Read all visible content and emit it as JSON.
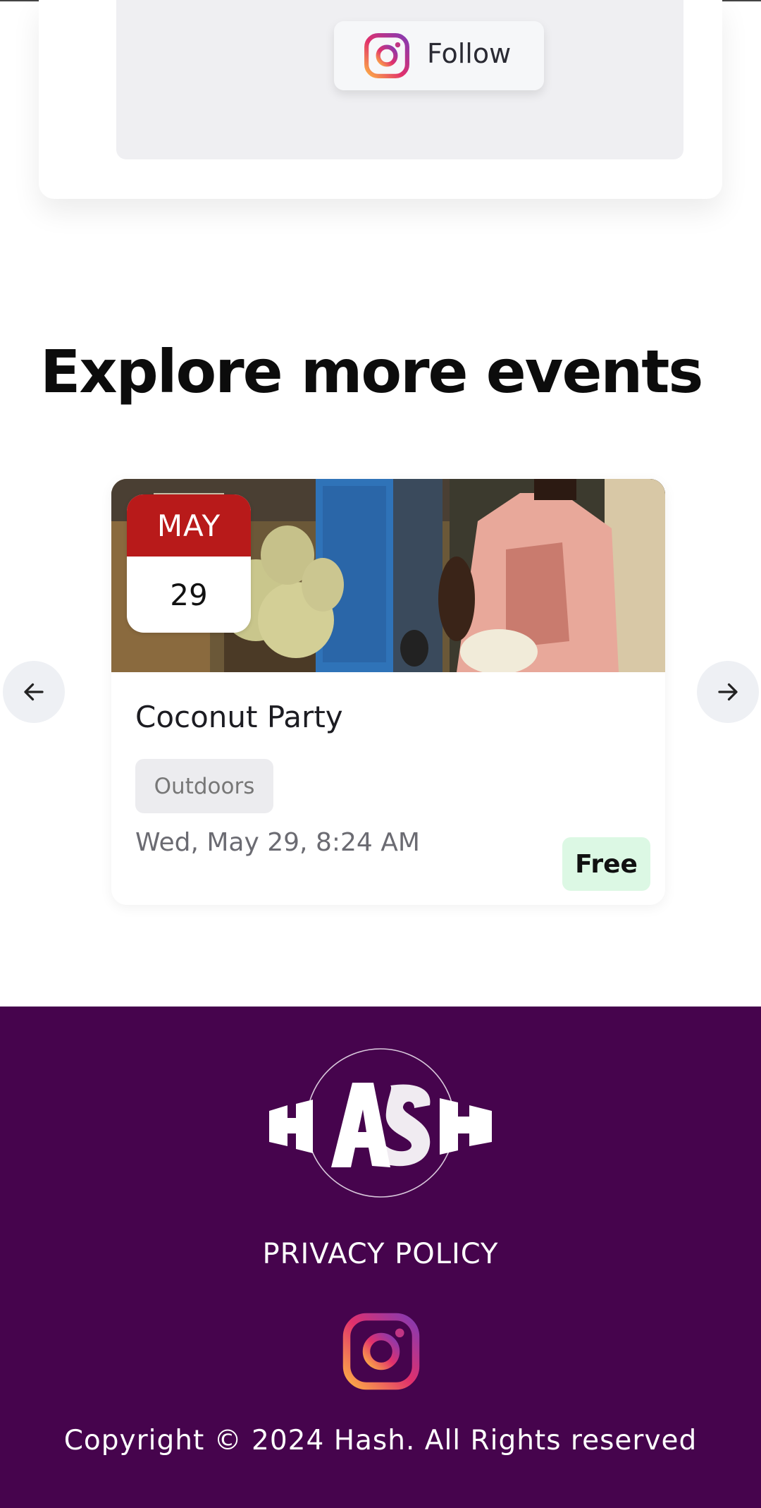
{
  "follow_card": {
    "follow_label": "Follow",
    "icon": "instagram-icon"
  },
  "section": {
    "heading": "Explore more events"
  },
  "carousel": {
    "prev_icon": "arrow-left-icon",
    "next_icon": "arrow-right-icon",
    "events": [
      {
        "month": "MAY",
        "day": "29",
        "title": "Coconut Party",
        "tag": "Outdoors",
        "datetime": "Wed, May 29, 8:24 AM",
        "price": "Free"
      }
    ]
  },
  "footer": {
    "logo_text": "HASH",
    "privacy_label": "PRIVACY POLICY",
    "social_icon": "instagram-icon",
    "copyright": "Copyright © 2024 Hash. All Rights reserved",
    "background": "#46044d"
  },
  "colors": {
    "month_red": "#b81a1a",
    "free_badge": "#dcf8e4",
    "tag_bg": "#ececef"
  }
}
